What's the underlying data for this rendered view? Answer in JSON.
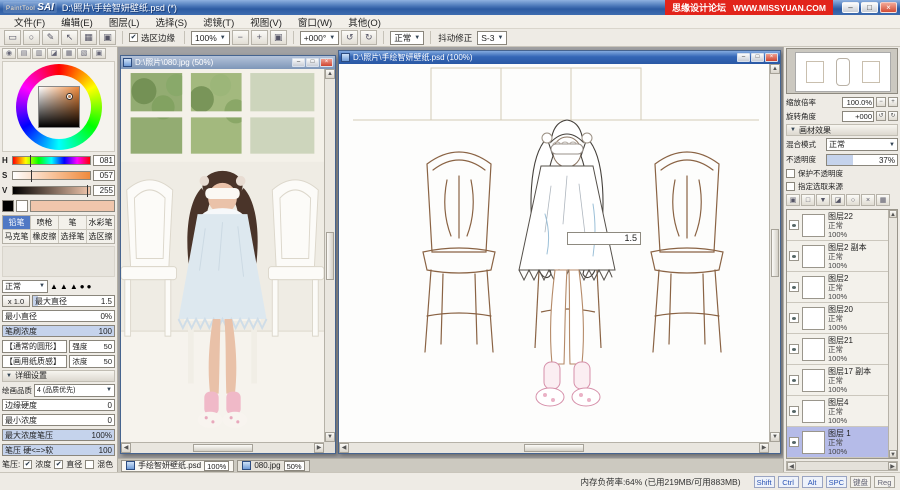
{
  "title_bar": {
    "logo_top": "PaintTool",
    "logo_main": "SAI",
    "title": "D:\\照片\\手绘智妍壁纸.psd (*)",
    "watermark_cn": "思缘设计论坛",
    "watermark_en": "WWW.MISSYUAN.COM"
  },
  "menu": {
    "items": [
      "文件(F)",
      "编辑(E)",
      "图层(L)",
      "选择(S)",
      "滤镜(T)",
      "视图(V)",
      "窗口(W)",
      "其他(O)"
    ]
  },
  "toolbar": {
    "selection_edge": "选区边缘",
    "zoom": "100%",
    "angle": "+000°",
    "blend": "正常",
    "stabilizer_label": "抖动修正",
    "stabilizer_value": "S-3"
  },
  "color_panel": {
    "h_label": "H",
    "h_value": "081",
    "s_label": "S",
    "s_value": "057",
    "v_label": "V",
    "v_value": "255",
    "current_color": "#f0c6ac"
  },
  "tools": {
    "items": [
      {
        "label": "铅笔"
      },
      {
        "label": "喷枪"
      },
      {
        "label": "笔"
      },
      {
        "label": "水彩笔"
      },
      {
        "label": "马克笔"
      },
      {
        "label": "橡皮擦"
      },
      {
        "label": "选择笔"
      },
      {
        "label": "选区擦"
      }
    ]
  },
  "brush": {
    "blend": "正常",
    "tips": [
      "▲",
      "▲",
      "▲",
      "●",
      "●"
    ],
    "max_diameter_label": "最大直径",
    "max_diameter_unit": "x 1.0",
    "max_diameter_value": "1.5",
    "min_diameter_label": "最小直径",
    "min_diameter_value": "0%",
    "density_label": "笔刷浓度",
    "density_value": "100",
    "shape_name": "【通常的圆形】",
    "shape_param": "强度",
    "shape_value": "50",
    "texture_name": "【画用纸质感】",
    "texture_param": "浓度",
    "texture_value": "50",
    "advanced_header": "详细设置",
    "quality_label": "绘画品质",
    "quality_value": "4 (品质优先)",
    "edge_label": "边缘硬度",
    "edge_value": "0",
    "min_density_label": "最小浓度",
    "min_density_value": "0",
    "max_pressure_label": "最大浓度笔压",
    "max_pressure_value": "100%",
    "hard_soft_label": "笔压 硬<=>软",
    "hard_soft_value": "100",
    "pressure_label": "笔压:",
    "pressure_density": "浓度",
    "pressure_diameter": "直径",
    "pressure_blend": "混色"
  },
  "windows": {
    "photo": {
      "title": "D:\\照片\\080.jpg (50%)"
    },
    "lineart": {
      "title": "D:\\照片\\手绘智妍壁纸.psd (100%)",
      "brush_hint": "1.5"
    }
  },
  "right_panel": {
    "nav_zoom_label": "缩放倍率",
    "nav_zoom_value": "100.0%",
    "nav_angle_label": "旋转角度",
    "nav_angle_value": "+000",
    "effect_header": "画材效果",
    "blend_label": "混合模式",
    "blend_value": "正常",
    "opacity_label": "不透明度",
    "opacity_value": "37%",
    "protect_opacity": "保护不透明度",
    "selection_source": "指定选取来源",
    "layers": [
      {
        "name": "图层22",
        "mode": "正常",
        "opacity": "100%"
      },
      {
        "name": "图层2 副本",
        "mode": "正常",
        "opacity": "100%"
      },
      {
        "name": "图层2",
        "mode": "正常",
        "opacity": "100%"
      },
      {
        "name": "图层20",
        "mode": "正常",
        "opacity": "100%"
      },
      {
        "name": "图层21",
        "mode": "正常",
        "opacity": "100%"
      },
      {
        "name": "图层17 副本",
        "mode": "正常",
        "opacity": "100%"
      },
      {
        "name": "图层4",
        "mode": "正常",
        "opacity": "100%"
      },
      {
        "name": "图层 1",
        "mode": "正常",
        "opacity": "100%"
      }
    ]
  },
  "tabs": {
    "items": [
      {
        "name": "手绘智妍壁纸.psd",
        "zoom": "100%"
      },
      {
        "name": "080.jpg",
        "zoom": "50%"
      }
    ]
  },
  "status_bar": {
    "memory": "内存负荷率:64% (已用219MB/可用883MB)",
    "keys": [
      "Shift",
      "Ctrl",
      "Alt",
      "SPC"
    ],
    "device": "键盘",
    "extra": "Reg"
  },
  "icons": {
    "dropdown": "▼",
    "up": "▲",
    "down": "▼",
    "left": "◀",
    "right": "▶",
    "close": "×",
    "minimize": "–",
    "maximize": "□",
    "check": "✔",
    "zoom_out": "−",
    "zoom_in": "+",
    "reset": "▣",
    "rotate_ccw": "↺",
    "rotate_cw": "↻",
    "marquee": "▭",
    "lasso": "○",
    "pen": "✎",
    "move": "↖",
    "grid": "▦",
    "wheel": "◉",
    "rows": "▤",
    "cols": "▥",
    "mix": "◪",
    "shade": "▧",
    "square": "▣"
  }
}
